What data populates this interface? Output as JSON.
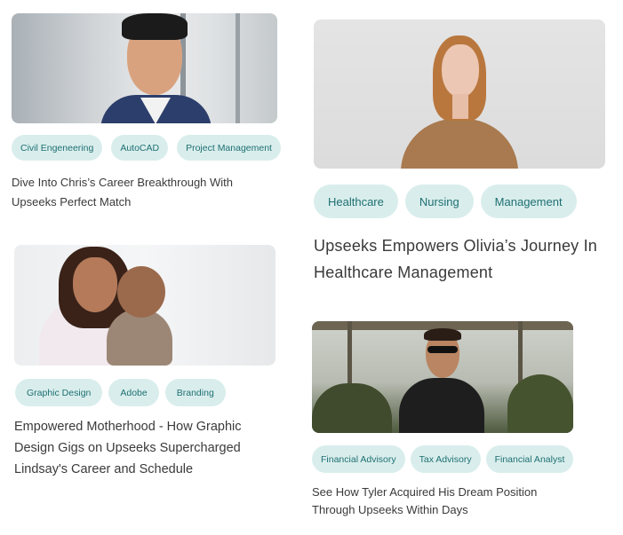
{
  "cards": [
    {
      "tags": [
        "Civil Engeneering",
        "AutoCAD",
        "Project Management"
      ],
      "title": "Dive Into Chris’s Career Breakthrough With Upseeks Perfect Match"
    },
    {
      "tags": [
        "Healthcare",
        "Nursing",
        "Management"
      ],
      "title": "Upseeks Empowers Olivia’s Journey In Healthcare Management"
    },
    {
      "tags": [
        "Graphic Design",
        "Adobe",
        "Branding"
      ],
      "title": "Empowered Motherhood - How Graphic Design Gigs on Upseeks Supercharged Lindsay's Career and Schedule"
    },
    {
      "tags": [
        "Financial Advisory",
        "Tax Advisory",
        "Financial Analyst"
      ],
      "title": "See How Tyler Acquired His Dream Position Through Upseeks Within Days"
    }
  ],
  "colors": {
    "tag_background": "#d9eeec",
    "tag_text": "#1f6f73",
    "title_text": "#3a3a3a"
  }
}
